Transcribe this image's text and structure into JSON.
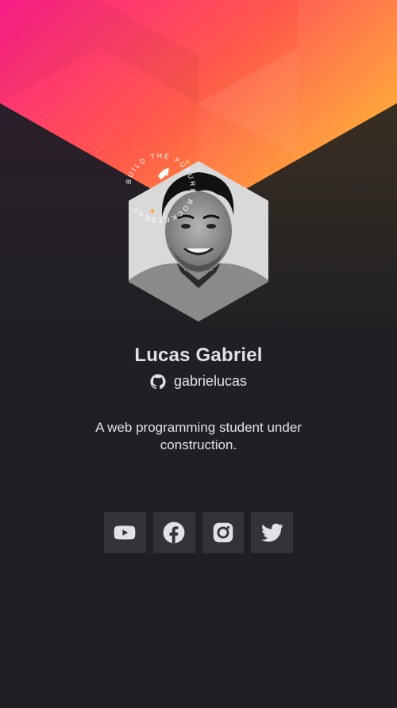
{
  "profile": {
    "name": "Lucas Gabriel",
    "github_handle": "gabrielucas",
    "bio": "A web programming student under construction.",
    "badge_text": "BUILD THE FUTURE  ROCKETSEAT"
  },
  "socials": [
    {
      "icon": "youtube-icon"
    },
    {
      "icon": "facebook-icon"
    },
    {
      "icon": "instagram-icon"
    },
    {
      "icon": "twitter-icon"
    }
  ],
  "colors": {
    "background": "#202024",
    "gradient_start": "#FF1E8B",
    "gradient_end": "#FFAA2E",
    "button_bg": "#323238",
    "text": "#E1E1E6"
  }
}
